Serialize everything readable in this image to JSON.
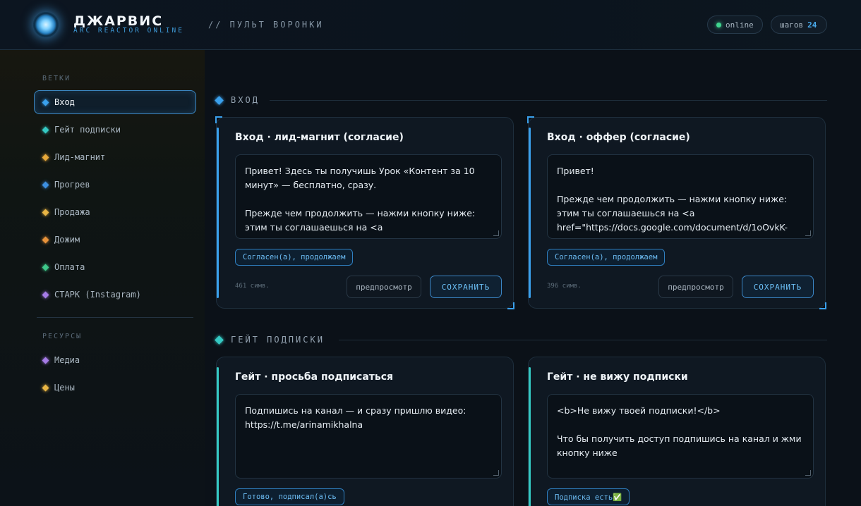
{
  "header": {
    "brand_title": "ДЖАРВИС",
    "brand_subtitle": "ARC REACTOR ONLINE",
    "section": "// ПУЛЬТ ВОРОНКИ",
    "status_label": "online",
    "steps_label": "шагов",
    "steps_count": "24"
  },
  "sidebar": {
    "branches_heading": "ВЕТКИ",
    "branches": [
      {
        "label": "Вход",
        "color": "#3aa0ec"
      },
      {
        "label": "Гейт подписки",
        "color": "#35c9c3"
      },
      {
        "label": "Лид-магнит",
        "color": "#e8a83a"
      },
      {
        "label": "Прогрев",
        "color": "#3d8fe0"
      },
      {
        "label": "Продажа",
        "color": "#e8b544"
      },
      {
        "label": "Дожим",
        "color": "#e7923a"
      },
      {
        "label": "Оплата",
        "color": "#3ec98a"
      },
      {
        "label": "СТАРК (Instagram)",
        "color": "#a57be6"
      }
    ],
    "resources_heading": "РЕСУРСЫ",
    "resources": [
      {
        "label": "Медиа",
        "color": "#a57be6"
      },
      {
        "label": "Цены",
        "color": "#e8b544"
      }
    ]
  },
  "sections": [
    {
      "title": "ВХОД",
      "color": "#3aa0ec",
      "cards": [
        {
          "title": "Вход · лид-магнит (согласие)",
          "text": "Привет! Здесь ты получишь Урок «Контент за 10 минут» — бесплатно, сразу.\n\nПрежде чем продолжить — нажми кнопку ниже: этим ты соглашаешься на <a",
          "chip": "Согласен(а), продолжаем",
          "char_count": "461 симв.",
          "preview_label": "предпросмотр",
          "save_label": "СОХРАНИТЬ"
        },
        {
          "title": "Вход · оффер (согласие)",
          "text": "Привет!\n\nПрежде чем продолжить — нажми кнопку ниже: этим ты соглашаешься на <a href=\"https://docs.google.com/document/d/1oOvkK-",
          "chip": "Согласен(а), продолжаем",
          "char_count": "396 симв.",
          "preview_label": "предпросмотр",
          "save_label": "СОХРАНИТЬ"
        }
      ]
    },
    {
      "title": "ГЕЙТ ПОДПИСКИ",
      "color": "#35c9c3",
      "cards": [
        {
          "title": "Гейт · просьба подписаться",
          "text": "Подпишись на канал — и сразу пришлю видео: https://t.me/arinamikhalna",
          "chip": "Готово, подписал(а)сь"
        },
        {
          "title": "Гейт · не вижу подписки",
          "text": "<b>Не вижу твоей подписки!</b>\n\nЧто бы получить доступ подпишись на канал и жми кнопку ниже",
          "chip": "Подписка есть✅"
        }
      ]
    }
  ]
}
